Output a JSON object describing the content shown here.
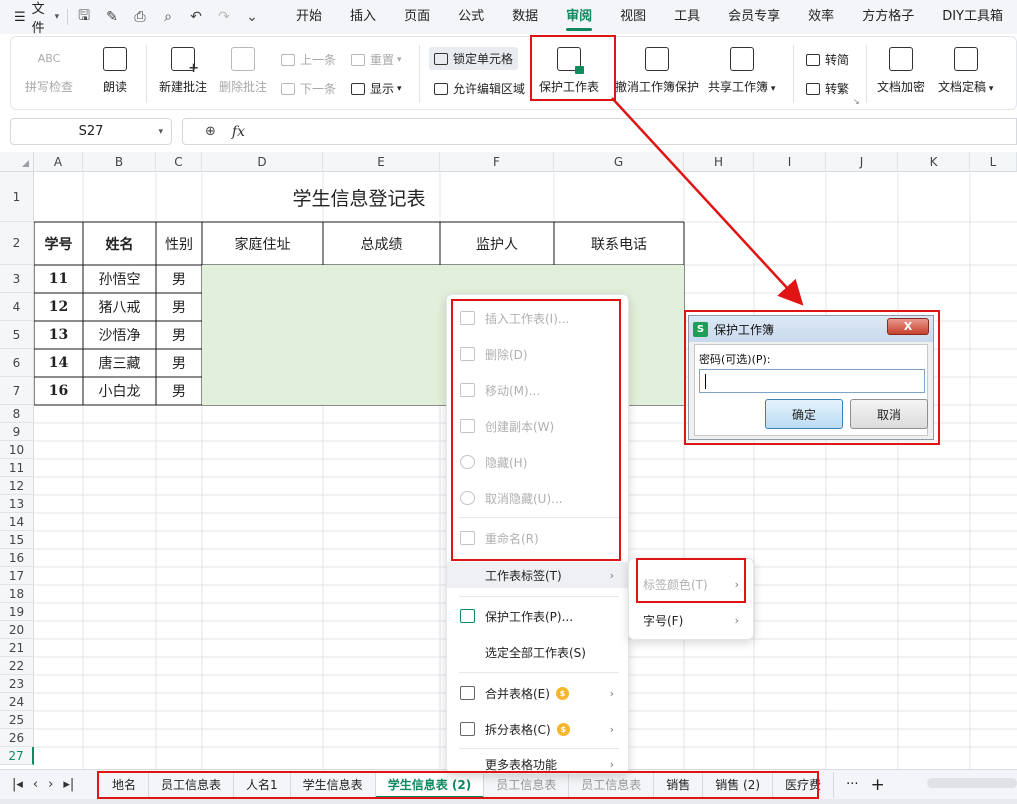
{
  "menubar": {
    "file_label": "文件",
    "tabs": [
      "开始",
      "插入",
      "页面",
      "公式",
      "数据",
      "审阅",
      "视图",
      "工具",
      "会员专享",
      "效率",
      "方方格子",
      "DIY工具箱"
    ],
    "active_tab": "审阅"
  },
  "ribbon": {
    "spell_check_icon": "ABC",
    "spell_check": "拼写检查",
    "read_aloud": "朗读",
    "new_comment": "新建批注",
    "delete_comment": "删除批注",
    "prev_comment": "上一条",
    "next_comment": "下一条",
    "reset": "重置",
    "show": "显示",
    "lock_cell": "锁定单元格",
    "allow_edit_range": "允许编辑区域",
    "protect_sheet": "保护工作表",
    "unprotect_workbook": "撤消工作簿保护",
    "share_workbook": "共享工作簿",
    "to_simplified": "转简",
    "to_traditional": "转繁",
    "doc_encrypt": "文档加密",
    "doc_finalize": "文档定稿"
  },
  "formula": {
    "name_box": "S27",
    "fx": "fx",
    "value": ""
  },
  "grid": {
    "columns": [
      "A",
      "B",
      "C",
      "D",
      "E",
      "F",
      "G",
      "H",
      "I",
      "J",
      "K",
      "L"
    ],
    "rows": [
      "1",
      "2",
      "3",
      "4",
      "5",
      "6",
      "7",
      "8",
      "9",
      "10",
      "11",
      "12",
      "13",
      "14",
      "15",
      "16",
      "17",
      "18",
      "19",
      "20",
      "21",
      "22",
      "23",
      "24",
      "25",
      "26",
      "27"
    ],
    "active_row": "27"
  },
  "table": {
    "title": "学生信息登记表",
    "headers": [
      "学号",
      "姓名",
      "性别",
      "家庭住址",
      "总成绩",
      "监护人",
      "联系电话"
    ],
    "rows": [
      {
        "id": "11",
        "name": "孙悟空",
        "gender": "男"
      },
      {
        "id": "12",
        "name": "猪八戒",
        "gender": "男"
      },
      {
        "id": "13",
        "name": "沙悟净",
        "gender": "男"
      },
      {
        "id": "14",
        "name": "唐三藏",
        "gender": "男"
      },
      {
        "id": "16",
        "name": "小白龙",
        "gender": "男"
      }
    ]
  },
  "context_menu": {
    "items": [
      {
        "label": "插入工作表(I)...",
        "disabled": true
      },
      {
        "label": "删除(D)",
        "disabled": true
      },
      {
        "label": "移动(M)...",
        "disabled": true
      },
      {
        "label": "创建副本(W)",
        "disabled": true
      },
      {
        "label": "隐藏(H)",
        "disabled": true
      },
      {
        "label": "取消隐藏(U)...",
        "disabled": true
      },
      {
        "label": "重命名(R)",
        "disabled": true
      },
      {
        "label": "工作表标签(T)",
        "disabled": false
      },
      {
        "label": "保护工作表(P)...",
        "disabled": false
      },
      {
        "label": "选定全部工作表(S)",
        "disabled": false
      },
      {
        "label": "合并表格(E)",
        "disabled": false
      },
      {
        "label": "拆分表格(C)",
        "disabled": false
      },
      {
        "label": "更多表格功能",
        "disabled": false
      }
    ],
    "coin_glyph": "$"
  },
  "submenu": {
    "tab_color": "标签颜色(T)",
    "font_size": "字号(F)"
  },
  "dialog": {
    "logo": "S",
    "title": "保护工作簿",
    "close": "X",
    "password_label": "密码(可选)(P):",
    "password_value": "",
    "ok": "确定",
    "cancel": "取消"
  },
  "sheet_tabs": {
    "tabs": [
      "地名",
      "员工信息表",
      "人名1",
      "学生信息表",
      "学生信息表 (2)",
      "员工信息表",
      "员工信息表",
      "销售",
      "销售 (2)",
      "医疗费"
    ],
    "active_index": 4,
    "more": "···",
    "add": "+"
  },
  "colors": {
    "accent": "#0f8a5f",
    "annotation_red": "#e01414",
    "table_fill": "#e2efda"
  }
}
